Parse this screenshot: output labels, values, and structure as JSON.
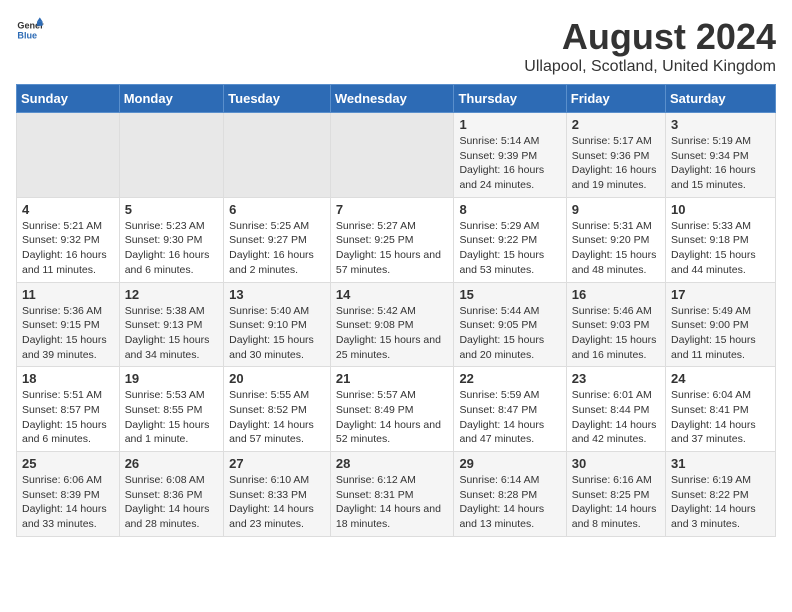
{
  "logo": {
    "line1": "General",
    "line2": "Blue"
  },
  "title": "August 2024",
  "subtitle": "Ullapool, Scotland, United Kingdom",
  "days_of_week": [
    "Sunday",
    "Monday",
    "Tuesday",
    "Wednesday",
    "Thursday",
    "Friday",
    "Saturday"
  ],
  "weeks": [
    [
      {
        "num": "",
        "detail": ""
      },
      {
        "num": "",
        "detail": ""
      },
      {
        "num": "",
        "detail": ""
      },
      {
        "num": "",
        "detail": ""
      },
      {
        "num": "1",
        "detail": "Sunrise: 5:14 AM\nSunset: 9:39 PM\nDaylight: 16 hours\nand 24 minutes."
      },
      {
        "num": "2",
        "detail": "Sunrise: 5:17 AM\nSunset: 9:36 PM\nDaylight: 16 hours\nand 19 minutes."
      },
      {
        "num": "3",
        "detail": "Sunrise: 5:19 AM\nSunset: 9:34 PM\nDaylight: 16 hours\nand 15 minutes."
      }
    ],
    [
      {
        "num": "4",
        "detail": "Sunrise: 5:21 AM\nSunset: 9:32 PM\nDaylight: 16 hours\nand 11 minutes."
      },
      {
        "num": "5",
        "detail": "Sunrise: 5:23 AM\nSunset: 9:30 PM\nDaylight: 16 hours\nand 6 minutes."
      },
      {
        "num": "6",
        "detail": "Sunrise: 5:25 AM\nSunset: 9:27 PM\nDaylight: 16 hours\nand 2 minutes."
      },
      {
        "num": "7",
        "detail": "Sunrise: 5:27 AM\nSunset: 9:25 PM\nDaylight: 15 hours\nand 57 minutes."
      },
      {
        "num": "8",
        "detail": "Sunrise: 5:29 AM\nSunset: 9:22 PM\nDaylight: 15 hours\nand 53 minutes."
      },
      {
        "num": "9",
        "detail": "Sunrise: 5:31 AM\nSunset: 9:20 PM\nDaylight: 15 hours\nand 48 minutes."
      },
      {
        "num": "10",
        "detail": "Sunrise: 5:33 AM\nSunset: 9:18 PM\nDaylight: 15 hours\nand 44 minutes."
      }
    ],
    [
      {
        "num": "11",
        "detail": "Sunrise: 5:36 AM\nSunset: 9:15 PM\nDaylight: 15 hours\nand 39 minutes."
      },
      {
        "num": "12",
        "detail": "Sunrise: 5:38 AM\nSunset: 9:13 PM\nDaylight: 15 hours\nand 34 minutes."
      },
      {
        "num": "13",
        "detail": "Sunrise: 5:40 AM\nSunset: 9:10 PM\nDaylight: 15 hours\nand 30 minutes."
      },
      {
        "num": "14",
        "detail": "Sunrise: 5:42 AM\nSunset: 9:08 PM\nDaylight: 15 hours\nand 25 minutes."
      },
      {
        "num": "15",
        "detail": "Sunrise: 5:44 AM\nSunset: 9:05 PM\nDaylight: 15 hours\nand 20 minutes."
      },
      {
        "num": "16",
        "detail": "Sunrise: 5:46 AM\nSunset: 9:03 PM\nDaylight: 15 hours\nand 16 minutes."
      },
      {
        "num": "17",
        "detail": "Sunrise: 5:49 AM\nSunset: 9:00 PM\nDaylight: 15 hours\nand 11 minutes."
      }
    ],
    [
      {
        "num": "18",
        "detail": "Sunrise: 5:51 AM\nSunset: 8:57 PM\nDaylight: 15 hours\nand 6 minutes."
      },
      {
        "num": "19",
        "detail": "Sunrise: 5:53 AM\nSunset: 8:55 PM\nDaylight: 15 hours\nand 1 minute."
      },
      {
        "num": "20",
        "detail": "Sunrise: 5:55 AM\nSunset: 8:52 PM\nDaylight: 14 hours\nand 57 minutes."
      },
      {
        "num": "21",
        "detail": "Sunrise: 5:57 AM\nSunset: 8:49 PM\nDaylight: 14 hours\nand 52 minutes."
      },
      {
        "num": "22",
        "detail": "Sunrise: 5:59 AM\nSunset: 8:47 PM\nDaylight: 14 hours\nand 47 minutes."
      },
      {
        "num": "23",
        "detail": "Sunrise: 6:01 AM\nSunset: 8:44 PM\nDaylight: 14 hours\nand 42 minutes."
      },
      {
        "num": "24",
        "detail": "Sunrise: 6:04 AM\nSunset: 8:41 PM\nDaylight: 14 hours\nand 37 minutes."
      }
    ],
    [
      {
        "num": "25",
        "detail": "Sunrise: 6:06 AM\nSunset: 8:39 PM\nDaylight: 14 hours\nand 33 minutes."
      },
      {
        "num": "26",
        "detail": "Sunrise: 6:08 AM\nSunset: 8:36 PM\nDaylight: 14 hours\nand 28 minutes."
      },
      {
        "num": "27",
        "detail": "Sunrise: 6:10 AM\nSunset: 8:33 PM\nDaylight: 14 hours\nand 23 minutes."
      },
      {
        "num": "28",
        "detail": "Sunrise: 6:12 AM\nSunset: 8:31 PM\nDaylight: 14 hours\nand 18 minutes."
      },
      {
        "num": "29",
        "detail": "Sunrise: 6:14 AM\nSunset: 8:28 PM\nDaylight: 14 hours\nand 13 minutes."
      },
      {
        "num": "30",
        "detail": "Sunrise: 6:16 AM\nSunset: 8:25 PM\nDaylight: 14 hours\nand 8 minutes."
      },
      {
        "num": "31",
        "detail": "Sunrise: 6:19 AM\nSunset: 8:22 PM\nDaylight: 14 hours\nand 3 minutes."
      }
    ]
  ]
}
